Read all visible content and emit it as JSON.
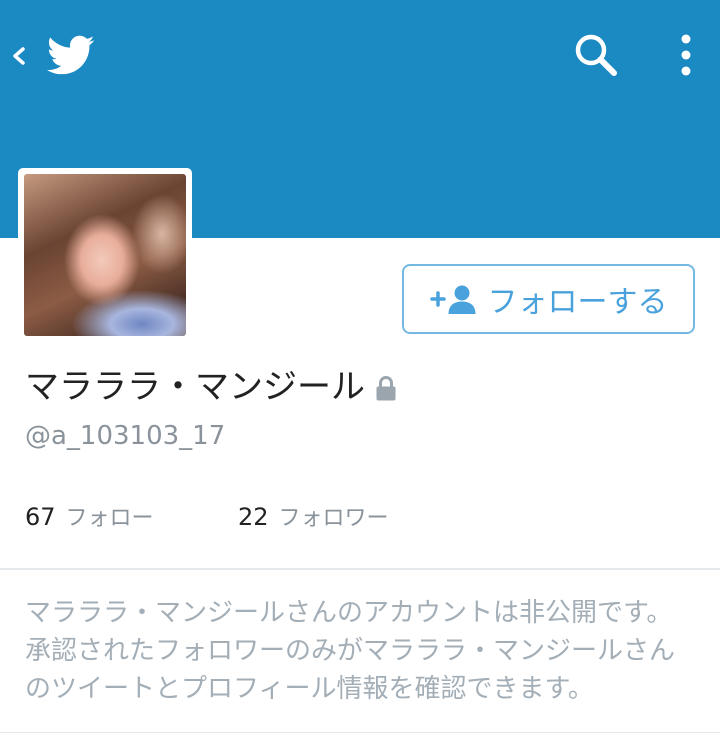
{
  "header": {
    "up_icon": "chevron-left-icon",
    "logo_icon": "twitter-bird-icon",
    "search_icon": "search-icon",
    "menu_icon": "more-vertical-icon"
  },
  "profile": {
    "display_name": "マラララ・マンジール",
    "lock_icon": "lock-icon",
    "handle": "@a_103103_17",
    "follow_button": {
      "icon": "add-user-icon",
      "label": "フォローする"
    },
    "stats": [
      {
        "count": "67",
        "label": "フォロー"
      },
      {
        "count": "22",
        "label": "フォロワー"
      }
    ]
  },
  "protected_notice": {
    "lines": [
      "マラララ・マンジールさんのアカウントは非公開です。",
      "承認されたフォロワーのみがマラララ・マンジールさん",
      "のツイートとプロフィール情報を確認できます。"
    ]
  },
  "colors": {
    "header_blue": "#1b89c2",
    "accent": "#4aa2dc",
    "text_primary": "#222222",
    "text_secondary": "#8a939b",
    "notice_text": "#a3aeb7",
    "divider": "#e4e8eb"
  }
}
